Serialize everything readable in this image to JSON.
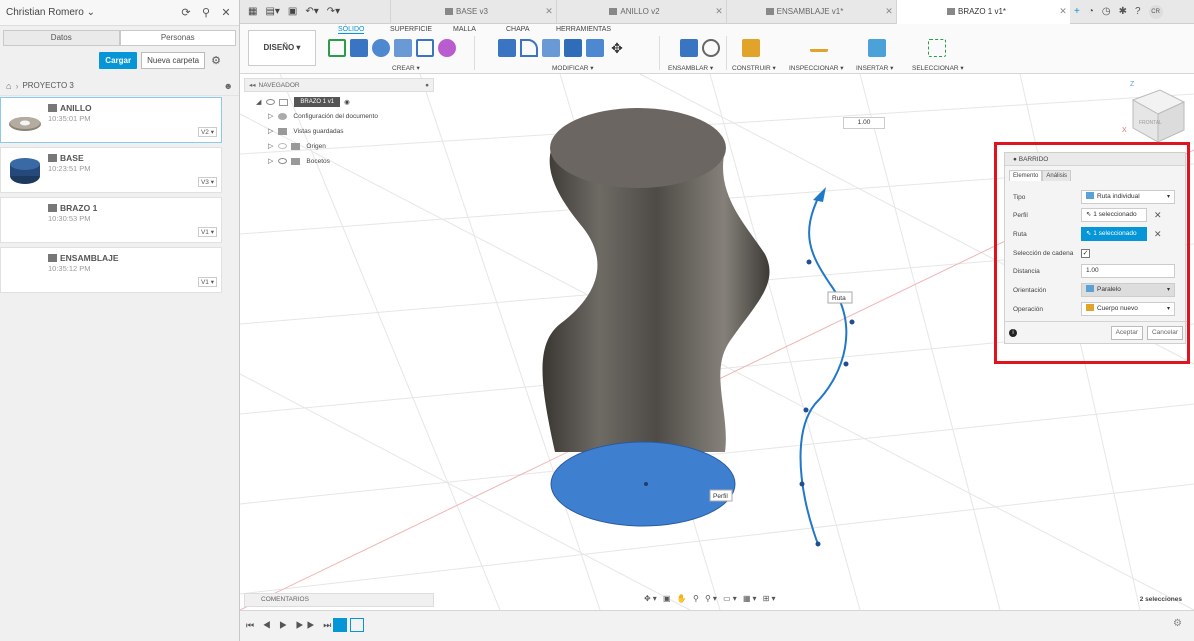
{
  "user": {
    "name": "Christian Romero",
    "initials": "CR"
  },
  "left_panel": {
    "tabs": [
      "Datos",
      "Personas"
    ],
    "upload_label": "Cargar",
    "new_folder_label": "Nueva carpeta",
    "project": "PROYECTO 3",
    "files": [
      {
        "name": "ANILLO",
        "time": "10:35:01 PM",
        "version": "V2 ▾"
      },
      {
        "name": "BASE",
        "time": "10:23:51 PM",
        "version": "V3 ▾"
      },
      {
        "name": "BRAZO 1",
        "time": "10:30:53 PM",
        "version": "V1 ▾"
      },
      {
        "name": "ENSAMBLAJE",
        "time": "10:35:12 PM",
        "version": "V1 ▾"
      }
    ]
  },
  "doc_tabs": [
    "BASE v3",
    "ANILLO v2",
    "ENSAMBLAJE v1*",
    "BRAZO 1 v1*"
  ],
  "ribbon": {
    "design_label": "DISEÑO ▾",
    "tabs": [
      "SÓLIDO",
      "SUPERFICIE",
      "MALLA",
      "CHAPA",
      "HERRAMIENTAS"
    ],
    "groups": [
      "CREAR ▾",
      "MODIFICAR ▾",
      "ENSAMBLAR ▾",
      "CONSTRUIR ▾",
      "INSPECCIONAR ▾",
      "INSERTAR ▾",
      "SELECCIONAR ▾"
    ]
  },
  "navigator": {
    "title": "NAVEGADOR",
    "root": "BRAZO 1 v1",
    "items": [
      "Configuración del documento",
      "Vistas guardadas",
      "Origen",
      "Bocetos"
    ]
  },
  "viewport": {
    "scale_value": "1.00",
    "path_label": "Ruta",
    "profile_label": "Perfil",
    "viewcube_label": "FRONTAL"
  },
  "barrido": {
    "title": "BARRIDO",
    "tabs": [
      "Elemento",
      "Análisis"
    ],
    "rows": {
      "tipo_label": "Tipo",
      "tipo_value": "Ruta individual",
      "perfil_label": "Perfil",
      "perfil_value": "1 seleccionado",
      "ruta_label": "Ruta",
      "ruta_value": "1 seleccionado",
      "cadena_label": "Selección de cadena",
      "distancia_label": "Distancia",
      "distancia_value": "1.00",
      "orientacion_label": "Orientación",
      "orientacion_value": "Paralelo",
      "operacion_label": "Operación",
      "operacion_value": "Cuerpo nuevo"
    },
    "accept_label": "Aceptar",
    "cancel_label": "Cancelar"
  },
  "bottom": {
    "comments_label": "COMENTARIOS",
    "selections_label": "2 selecciones"
  },
  "colors": {
    "accent": "#0696d7",
    "highlight": "#e0141e",
    "profile_blue": "#3f7fd0"
  }
}
